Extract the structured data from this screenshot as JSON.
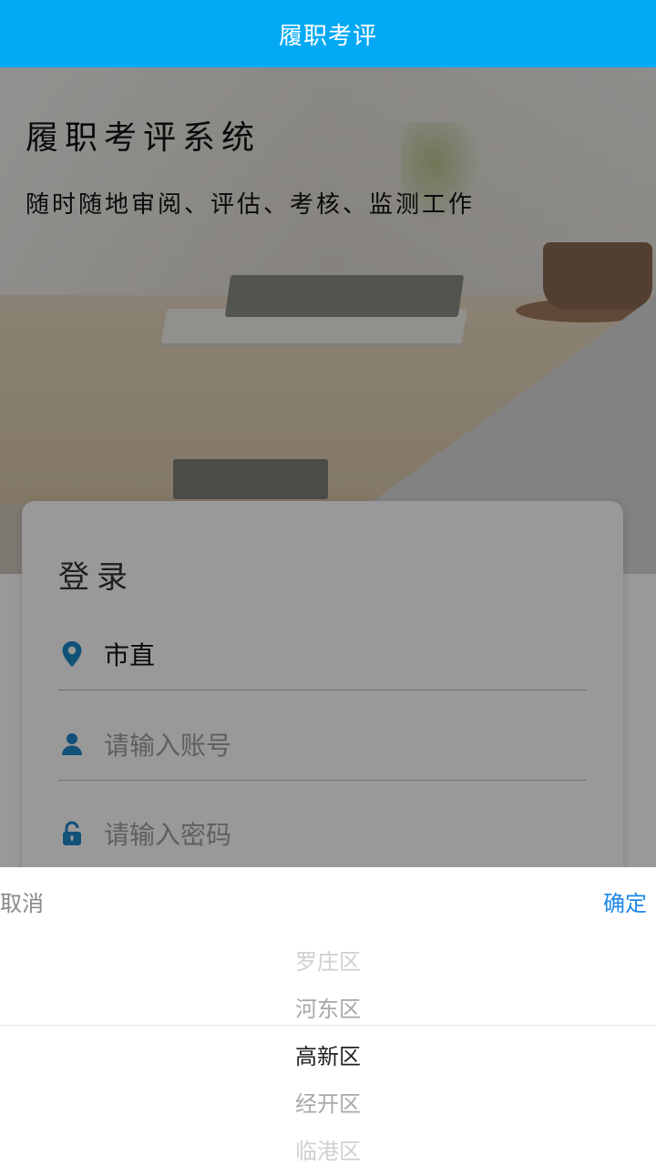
{
  "app_bar": {
    "title": "履职考评"
  },
  "hero": {
    "title": "履职考评系统",
    "subtitle": "随时随地审阅、评估、考核、监测工作"
  },
  "login": {
    "title": "登录",
    "region_value": "市直",
    "account_placeholder": "请输入账号",
    "password_placeholder": "请输入密码"
  },
  "picker": {
    "cancel_label": "取消",
    "confirm_label": "确定",
    "options": [
      "罗庄区",
      "河东区",
      "高新区",
      "经开区",
      "临港区"
    ],
    "selected": "高新区"
  },
  "colors": {
    "app_bar": "#03a9f4",
    "icon": "#1e88c8",
    "confirm": "#1e88e5"
  },
  "icons": {
    "region": "location-pin-icon",
    "account": "user-icon",
    "password": "lock-icon"
  }
}
